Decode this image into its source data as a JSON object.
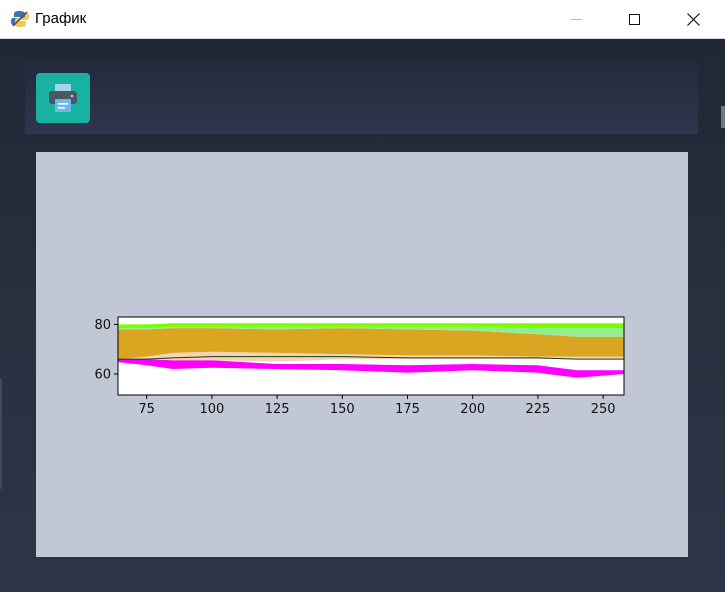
{
  "window": {
    "title": "График",
    "app_icon": "python-icon",
    "controls": [
      "minimize-icon",
      "maximize-icon",
      "close-icon"
    ]
  },
  "toolbar": {
    "print_button_icon": "printer-icon",
    "print_button_color": "#18b2a1"
  },
  "colors": {
    "background": "#1f2838",
    "plot_panel": "#c1c7d5"
  },
  "chart_data": {
    "type": "area",
    "title": "",
    "xlabel": "",
    "ylabel": "",
    "xlim": [
      64,
      258
    ],
    "ylim": [
      51.5,
      83
    ],
    "grid": false,
    "x_ticks": [
      75,
      100,
      125,
      150,
      175,
      200,
      225,
      250
    ],
    "y_ticks": [
      60,
      80
    ],
    "x": [
      64,
      75,
      85,
      100,
      125,
      150,
      175,
      200,
      225,
      240,
      258
    ],
    "bands": [
      {
        "color": "#ff00ff",
        "lower": [
          64.8,
          63.5,
          62.0,
          62.5,
          62.0,
          61.5,
          60.5,
          61.5,
          60.5,
          58.5,
          60.0
        ],
        "upper": [
          66.0,
          66.0,
          65.5,
          65.5,
          64.0,
          64.0,
          63.5,
          64.0,
          63.5,
          61.5,
          61.5
        ]
      },
      {
        "color": "#f5d5b0",
        "lower": [
          66.0,
          66.0,
          65.5,
          65.5,
          65.0,
          66.0,
          66.0,
          66.0,
          66.0,
          66.0,
          66.0
        ],
        "upper": [
          66.0,
          67.0,
          68.5,
          69.0,
          68.5,
          68.0,
          67.5,
          67.5,
          67.0,
          67.0,
          67.0
        ]
      },
      {
        "color": "#daa520",
        "lower": [
          66.0,
          67.0,
          68.5,
          69.0,
          68.5,
          68.0,
          67.5,
          67.5,
          67.0,
          67.0,
          67.0
        ],
        "upper": [
          78.0,
          78.0,
          78.5,
          78.5,
          78.0,
          78.5,
          78.0,
          77.5,
          76.0,
          75.0,
          75.0
        ]
      },
      {
        "color": "#90ee90",
        "lower": [
          78.0,
          78.0,
          78.5,
          78.5,
          78.0,
          78.5,
          78.0,
          77.5,
          76.0,
          75.0,
          75.0
        ],
        "upper": [
          78.5,
          78.5,
          79.0,
          79.0,
          79.0,
          79.0,
          79.0,
          79.0,
          78.5,
          78.5,
          78.5
        ]
      },
      {
        "color": "#7cfc00",
        "lower": [
          78.5,
          78.5,
          79.0,
          79.0,
          79.0,
          79.0,
          79.0,
          79.0,
          78.5,
          78.5,
          78.5
        ],
        "upper": [
          80.0,
          80.0,
          80.5,
          80.5,
          80.5,
          80.5,
          80.5,
          80.5,
          80.5,
          80.5,
          80.5
        ]
      }
    ],
    "line": {
      "color": "#1a3a1a",
      "y": [
        66.0,
        66.0,
        66.5,
        67.0,
        67.0,
        67.0,
        66.5,
        66.5,
        66.5,
        66.0,
        66.0
      ]
    }
  }
}
